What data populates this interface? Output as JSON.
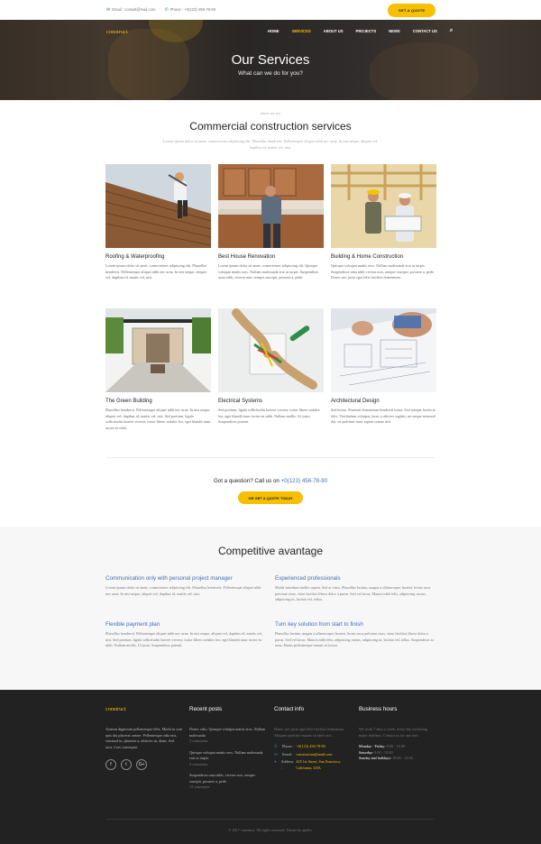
{
  "topbar": {
    "email_label": "Email : consult@mail.com",
    "phone_label": "Phone : +0(123) 456-78-90",
    "quote_button": "GET A QUOTE"
  },
  "header": {
    "logo": "construct",
    "nav": [
      "HOME",
      "SERVICES",
      "ABOUT US",
      "PROJECTS",
      "NEWS",
      "CONTACT US"
    ],
    "active_nav": "SERVICES",
    "search_icon": "search-icon"
  },
  "hero": {
    "title": "Our Services",
    "subtitle": "What can we do for you?"
  },
  "services": {
    "kicker": "what we do",
    "title": "Commercial construction services",
    "description": "Lorem ipsum dolor sit amet, consectetuer adipiscing elit. Phasellus hendrerit. Pellentesque aliquet nibh nec urna. In nisi neque, aliquet vel, dapibus id, mattis vel, nisi.",
    "items": [
      {
        "name": "Roofing & Waterproofing",
        "text": "Lorem ipsum dolor sit amet, consectetuer adipiscing elit. Phasellus hendrerit. Pellentesque aliquet nibh nec urna. In nisi neque, aliquet vel, dapibus id, mattis vel, nisi."
      },
      {
        "name": "Best House Renovation",
        "text": "Lorem ipsum dolor sit amet, consectetuer adipiscing elit. Quisque volutpat mattis eros. Nullam malesuada erat ut turpis. Suspendisse urna nibh, viverra non, semper suscipit, posuere a, pede."
      },
      {
        "name": "Building & Home Construction",
        "text": "Quisque volutpat mattis eros. Nullam malesuada erat ut turpis. Suspendisse urna nibh viverra non, semper suscipit, posuere a, pede. Donec nec justo eget felis facilisis fermentum."
      },
      {
        "name": "The Green Building",
        "text": "Phasellus hendrerit. Pellentesque aliquet nibh nec urna. In nisi neque, aliquet vel, dapibus id, mattis vel, nisi. Sed pretium, ligula sollicitudin laoreet viverra, tortor libero sodales leo, eget blandit nunc tortor eu nibh."
      },
      {
        "name": "Electrical Systems",
        "text": "Sed pretium, ligula sollicitudin laoreet viverra, tortor libero sodales leo, eget blandit nunc tortor eu nibh. Nullam mollis. Ut justo. Suspendisse potenti."
      },
      {
        "name": "Architectural Design",
        "text": "Sed lectus. Praesent elementum hendrerit tortor. Sed semper lorem at felis. Vestibulum volutpat, lacus a ultrices sagittis, mi neque euismod dui, eu pulvinar nunc sapien ornare nisl."
      }
    ]
  },
  "question": {
    "text": "Got a question? Call us on",
    "phone": "+0(123) 456-78-90",
    "button": "OR GET A QUOTE TODAY"
  },
  "advantage": {
    "title": "Competitive avantage",
    "items": [
      {
        "title": "Communication only with personal project manager",
        "text": "Lorem ipsum dolor sit amet, consectetuer adipiscing elit. Phasellus hendrerit. Pellentesque aliquet nibh nec urna. In nisi neque, aliquet vel, dapibus id, mattis vel, nisi."
      },
      {
        "title": "Experienced professionals",
        "text": "Morbi interdum mollis sapien. Sed ac risus. Phasellus lacinia, magna a ullamcorper laoreet, lectus arcu pulvinar risus, vitae facilisis libero dolor a purus. Sed vel lacus. Mauris nibh felis, adipiscing varius, adipiscing in, lacinia vel, tellus."
      },
      {
        "title": "Flexible payment plan",
        "text": "Phasellus hendrerit. Pellentesque aliquet nibh nec urna. In nisi neque, aliquet vel, dapibus id, mattis vel, nisi. Sed pretium, ligula sollicitudin laoreet viverra, tortor libero sodales leo, eget blandit nunc tortor eu nibh. Nullam mollis. Ut justo. Suspendisse potenti."
      },
      {
        "title": "Turn key solution from start to finish",
        "text": "Phasellus lacinia, magna a ullamcorper laoreet, lectus arcu pulvinar risus, vitae facilisis libero dolor a purus. Sed vel lacus. Mauris nibh felis, adipiscing varius, adipiscing in, lacinia vel, tellus. Suspendisse ac urna. Etiam pellentesque mauris ut lectus."
      }
    ]
  },
  "footer": {
    "brand": "construct",
    "about": "Aenean dignissim pellentesque felis. Morbi in sem quis dui placerat ornare. Pellentesque odio nisi, euismod in, pharetra a, ultricies in, diam. Sed arcu. Cras consequat.",
    "social": [
      "f",
      "t",
      "G+"
    ],
    "recent_title": "Recent posts",
    "posts": [
      {
        "text": "Donec odio. Quisque volutpat mattis eros. Nullam malesuada",
        "comments": "3 comments"
      },
      {
        "text": "Quisque volutpat mattis eros. Nullam malesuada erat ut turpis.",
        "comments": "2 comments"
      },
      {
        "text": "Suspendisse urna nibh, viverra non, semper suscipit, posuere a, pede.",
        "comments": "13 comments"
      }
    ],
    "contact_title": "Contact info",
    "contact_intro": "Donec nec justo eget felis facilisis fermentum. Aliquam porttitor mauris sit amet orci.",
    "phone_label": "Phone :",
    "phone": "+0(123) 456-78-90",
    "email_label": "Email :",
    "email": "construction@mail.com",
    "address_label": "Address :",
    "address": "425 1st Street, San Francisco, California, USA",
    "hours_title": "Business hours",
    "hours_intro": "We work 7 days a week, every day excluding major holidays. Contact us for any info.",
    "hours": [
      {
        "day": "Monday - Friday:",
        "time": "8:00 - 16:00"
      },
      {
        "day": "Saturday:",
        "time": "9:00 - 15:00"
      },
      {
        "day": "Sunday and holidays:",
        "time": "10:00 - 13:00"
      }
    ],
    "copyright": "© 2017 construct. All rights reserved. Theme by apollo."
  },
  "colors": {
    "accent": "#f6c000",
    "link": "#3f6fb5",
    "footer_bg": "#222222"
  }
}
